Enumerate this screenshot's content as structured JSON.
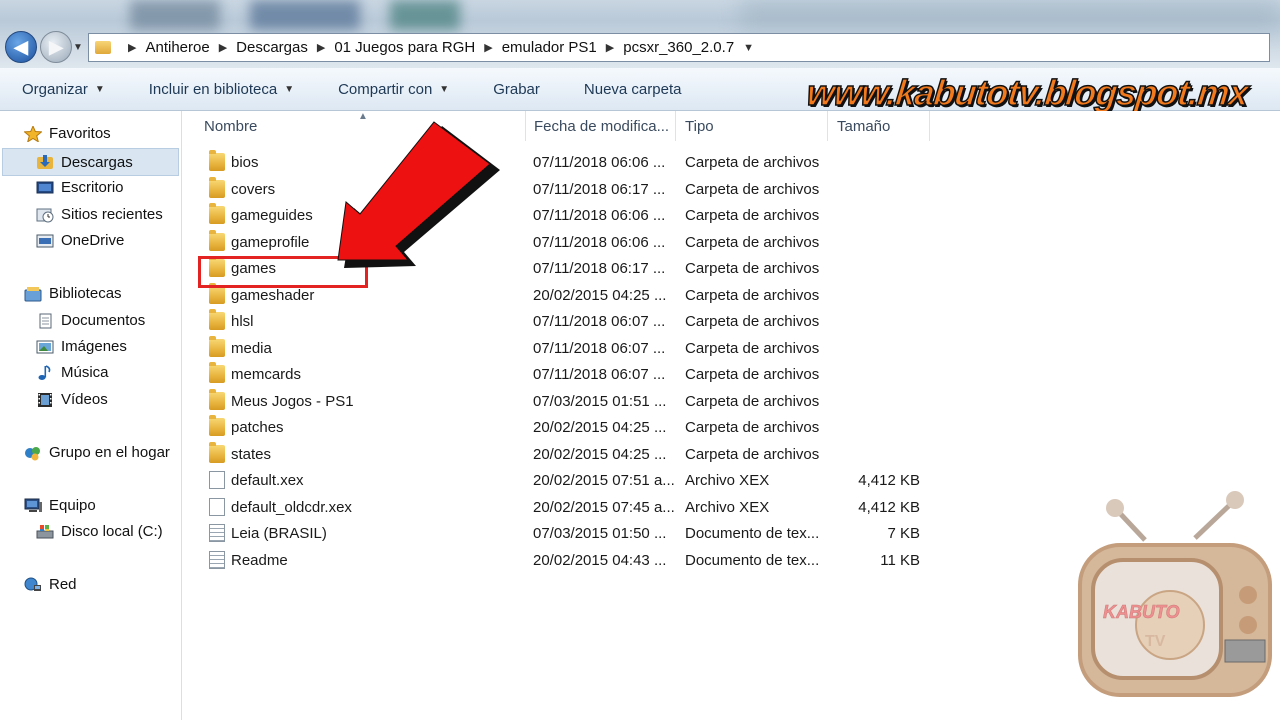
{
  "address": {
    "crumbs": [
      "Antiheroe",
      "Descargas",
      "01 Juegos para RGH",
      "emulador PS1",
      "pcsxr_360_2.0.7"
    ]
  },
  "toolbar": {
    "organize": "Organizar",
    "include": "Incluir en biblioteca",
    "share": "Compartir con",
    "burn": "Grabar",
    "new_folder": "Nueva carpeta"
  },
  "watermark": "www.kabutotv.blogspot.mx",
  "sidebar": {
    "favorites": "Favoritos",
    "downloads": "Descargas",
    "desktop": "Escritorio",
    "recent": "Sitios recientes",
    "onedrive": "OneDrive",
    "libraries": "Bibliotecas",
    "documents": "Documentos",
    "images": "Imágenes",
    "music": "Música",
    "videos": "Vídeos",
    "homegroup": "Grupo en el hogar",
    "computer": "Equipo",
    "localdisk": "Disco local (C:)",
    "network": "Red"
  },
  "columns": {
    "name": "Nombre",
    "date": "Fecha de modifica...",
    "type": "Tipo",
    "size": "Tamaño"
  },
  "files": [
    {
      "name": "bios",
      "date": "07/11/2018 06:06 ...",
      "type": "Carpeta de archivos",
      "size": "",
      "icon": "folder-icon"
    },
    {
      "name": "covers",
      "date": "07/11/2018 06:17 ...",
      "type": "Carpeta de archivos",
      "size": "",
      "icon": "folder-icon"
    },
    {
      "name": "gameguides",
      "date": "07/11/2018 06:06 ...",
      "type": "Carpeta de archivos",
      "size": "",
      "icon": "folder-icon"
    },
    {
      "name": "gameprofile",
      "date": "07/11/2018 06:06 ...",
      "type": "Carpeta de archivos",
      "size": "",
      "icon": "folder-icon"
    },
    {
      "name": "games",
      "date": "07/11/2018 06:17 ...",
      "type": "Carpeta de archivos",
      "size": "",
      "icon": "folder-icon"
    },
    {
      "name": "gameshader",
      "date": "20/02/2015 04:25 ...",
      "type": "Carpeta de archivos",
      "size": "",
      "icon": "folder-icon"
    },
    {
      "name": "hlsl",
      "date": "07/11/2018 06:07 ...",
      "type": "Carpeta de archivos",
      "size": "",
      "icon": "folder-icon"
    },
    {
      "name": "media",
      "date": "07/11/2018 06:07 ...",
      "type": "Carpeta de archivos",
      "size": "",
      "icon": "folder-icon"
    },
    {
      "name": "memcards",
      "date": "07/11/2018 06:07 ...",
      "type": "Carpeta de archivos",
      "size": "",
      "icon": "folder-icon"
    },
    {
      "name": "Meus Jogos - PS1",
      "date": "07/03/2015 01:51 ...",
      "type": "Carpeta de archivos",
      "size": "",
      "icon": "folder-icon"
    },
    {
      "name": "patches",
      "date": "20/02/2015 04:25 ...",
      "type": "Carpeta de archivos",
      "size": "",
      "icon": "folder-icon"
    },
    {
      "name": "states",
      "date": "20/02/2015 04:25 ...",
      "type": "Carpeta de archivos",
      "size": "",
      "icon": "folder-icon"
    },
    {
      "name": "default.xex",
      "date": "20/02/2015 07:51 a...",
      "type": "Archivo XEX",
      "size": "4,412 KB",
      "icon": "file-icon"
    },
    {
      "name": "default_oldcdr.xex",
      "date": "20/02/2015 07:45 a...",
      "type": "Archivo XEX",
      "size": "4,412 KB",
      "icon": "file-icon"
    },
    {
      "name": "Leia (BRASIL)",
      "date": "07/03/2015 01:50 ...",
      "type": "Documento de tex...",
      "size": "7 KB",
      "icon": "text-document-icon"
    },
    {
      "name": "Readme",
      "date": "20/02/2015 04:43 ...",
      "type": "Documento de tex...",
      "size": "11 KB",
      "icon": "text-document-icon"
    }
  ],
  "highlighted_row": "games",
  "logo_text": {
    "brand": "KABUTO",
    "sub": "TV"
  }
}
